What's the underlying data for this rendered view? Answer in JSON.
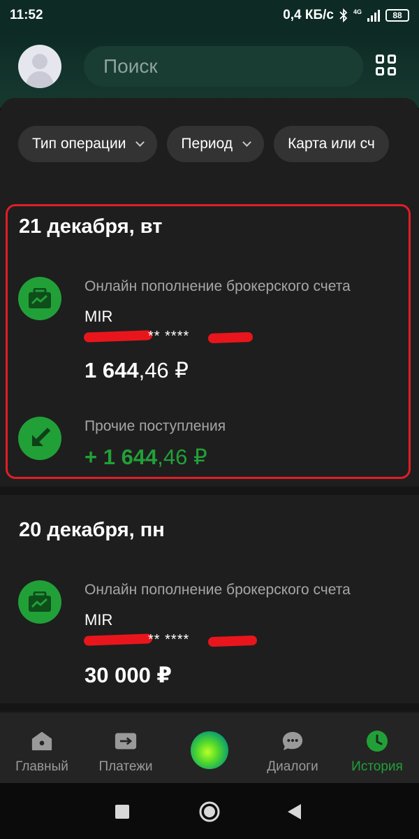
{
  "status_bar": {
    "time": "11:52",
    "net_speed": "0,4 КБ/с",
    "net_type": "4G",
    "battery": "88",
    "icons": [
      "bluetooth-icon",
      "signal-icon",
      "battery-icon"
    ]
  },
  "header": {
    "search_placeholder": "Поиск",
    "icons": [
      "avatar-icon",
      "grid-menu-icon"
    ]
  },
  "filters": [
    {
      "label": "Тип операции"
    },
    {
      "label": "Период"
    },
    {
      "label": "Карта или сч"
    }
  ],
  "days": [
    {
      "date": "21 декабря, вт",
      "operations": [
        {
          "category": "Онлайн пополнение брокерского счета",
          "card": "MIR",
          "masked_number": "** ****",
          "amount_int": "1 644",
          "amount_frac": ",46 ₽",
          "icon": "briefcase-chart-icon"
        },
        {
          "category": "Прочие поступления",
          "amount_int": "+ 1 644",
          "amount_frac": ",46 ₽",
          "icon": "arrow-down-left-icon"
        }
      ]
    },
    {
      "date": "20 декабря, пн",
      "operations": [
        {
          "category": "Онлайн пополнение брокерского счета",
          "card": "MIR",
          "masked_number": "** ****",
          "amount_int": "30 000 ₽",
          "amount_frac": "",
          "icon": "briefcase-chart-icon"
        }
      ]
    }
  ],
  "tabs": [
    {
      "label": "Главный",
      "icon": "home-icon"
    },
    {
      "label": "Платежи",
      "icon": "transfer-icon"
    },
    {
      "label": "",
      "icon": "salute-orb-icon"
    },
    {
      "label": "Диалоги",
      "icon": "chat-icon"
    },
    {
      "label": "История",
      "icon": "clock-icon",
      "active": true
    }
  ],
  "colors": {
    "accent_green": "#21a038",
    "highlight_red": "#e01e26",
    "background": "#1e1e1e"
  }
}
